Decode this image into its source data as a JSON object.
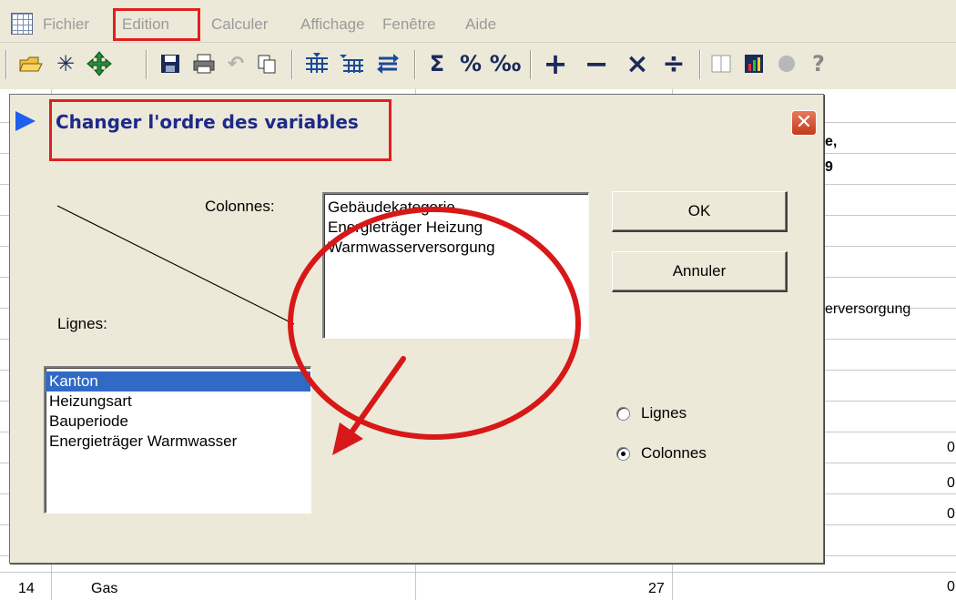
{
  "menubar": {
    "items": [
      "Fichier",
      "Edition",
      "Calculer",
      "Affichage",
      "Fenêtre",
      "Aide"
    ]
  },
  "toolbar": {
    "buttons": [
      "open-icon",
      "asterisk-icon",
      "move-icon",
      "save-icon",
      "print-icon",
      "undo-icon",
      "copy-icon",
      "insert-rows-icon",
      "insert-columns-icon",
      "swap-icon",
      "sigma",
      "percent",
      "permille",
      "plus",
      "minus",
      "times",
      "divide",
      "split-view-icon",
      "chart-icon",
      "circle-icon",
      "help-icon"
    ],
    "glyphs": {
      "sigma": "Σ",
      "percent": "%",
      "permille": "‰",
      "plus": "+",
      "minus": "−",
      "times": "×",
      "divide": "÷"
    }
  },
  "background_sheet": {
    "fragments": {
      "header_frag_1": "e,",
      "header_frag_2": "9",
      "col_frag": "erversorgung",
      "zero": "0",
      "row_num": "14",
      "row_label": "Gas",
      "row_value": "27"
    }
  },
  "dialog": {
    "title": "Changer l'ordre des variables",
    "close_glyph": "✕",
    "colonnes_label": "Colonnes:",
    "lignes_label": "Lignes:",
    "columns_list": [
      "Gebäudekategorie",
      "Energieträger Heizung",
      "Warmwasserversorgung"
    ],
    "rows_list": [
      "Kanton",
      "Heizungsart",
      "Bauperiode",
      "Energieträger Warmwasser"
    ],
    "rows_selected": "Kanton",
    "ok_label": "OK",
    "cancel_label": "Annuler",
    "radio_lignes": "Lignes",
    "radio_colonnes": "Colonnes",
    "radio_selected": "Colonnes"
  },
  "annotation_colors": {
    "highlight": "#e02020",
    "selection": "#316ac5"
  }
}
